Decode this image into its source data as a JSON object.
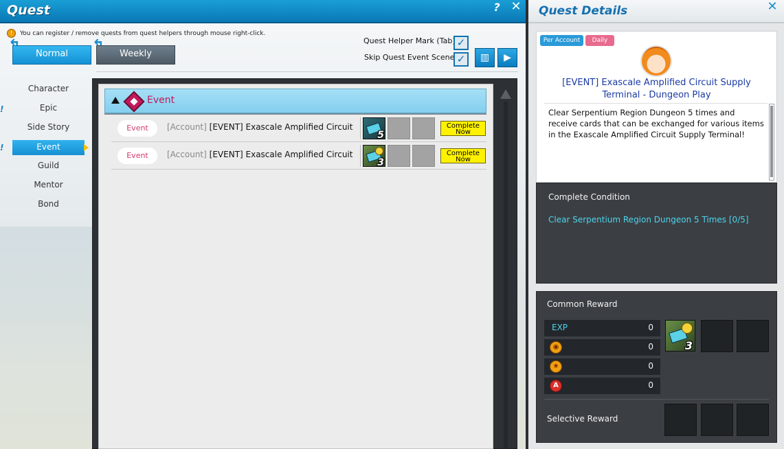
{
  "quest_window": {
    "title": "Quest",
    "help_label": "?",
    "close_label": "✕",
    "notice": "You can register / remove quests from quest helpers through mouse right-click.",
    "tabs": [
      {
        "label": "Normal",
        "selected": true
      },
      {
        "label": "Weekly",
        "selected": false
      }
    ],
    "options": {
      "helper_mark": "Quest Helper Mark (Tab)",
      "skip_scenes": "Skip Quest Event Scenes"
    },
    "categories": [
      {
        "label": "Character"
      },
      {
        "label": "Epic"
      },
      {
        "label": "Side Story"
      },
      {
        "label": "Event",
        "selected": true
      },
      {
        "label": "Guild"
      },
      {
        "label": "Mentor"
      },
      {
        "label": "Bond"
      }
    ],
    "group_header": "Event",
    "quests": [
      {
        "tag": "Event",
        "prefix": "[Account]",
        "title": "[EVENT] Exascale Amplified Circuit Su",
        "reward_count": "5",
        "action": "Complete Now"
      },
      {
        "tag": "Event",
        "prefix": "[Account]",
        "title": "[EVENT] Exascale Amplified Circuit Su",
        "reward_count": "3",
        "action": "Complete Now"
      }
    ]
  },
  "details_window": {
    "title": "Quest Details",
    "close_label": "✕",
    "badges": [
      {
        "label": "Per Account",
        "color": "#2a9ad8"
      },
      {
        "label": "Daily",
        "color": "#e86a8f"
      }
    ],
    "quest_title": "[EVENT] Exascale Amplified Circuit Supply Terminal - Dungeon Play",
    "description": "Clear Serpentium Region Dungeon 5 times and receive cards that can be exchanged for various items in the Exascale Amplified Circuit Supply Terminal!",
    "complete_condition": {
      "heading": "Complete Condition",
      "text": "Clear Serpentium Region Dungeon 5 Times  [0/5]"
    },
    "common_reward": {
      "heading": "Common Reward",
      "rows": [
        {
          "label": "EXP",
          "value": "0"
        },
        {
          "icon": "ed-coin-icon",
          "value": "0"
        },
        {
          "icon": "star-icon",
          "value": "0"
        },
        {
          "icon": "a-point-icon",
          "value": "0"
        }
      ],
      "item_count": "3"
    },
    "selective_reward": {
      "heading": "Selective Reward"
    }
  }
}
